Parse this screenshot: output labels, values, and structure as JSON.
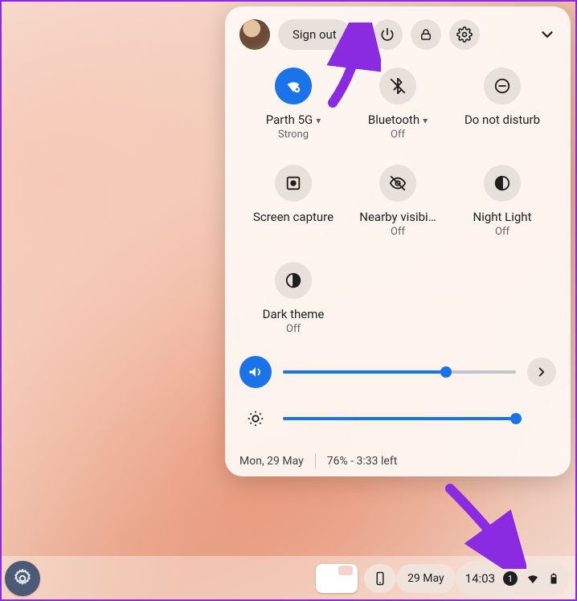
{
  "panel": {
    "signout_label": "Sign out",
    "tiles": [
      {
        "id": "wifi",
        "label": "Parth 5G",
        "sub": "Strong",
        "on": true,
        "has_chevron": true
      },
      {
        "id": "bluetooth",
        "label": "Bluetooth",
        "sub": "Off",
        "on": false,
        "has_chevron": true
      },
      {
        "id": "dnd",
        "label": "Do not disturb",
        "sub": "",
        "on": false,
        "has_chevron": false
      },
      {
        "id": "screencap",
        "label": "Screen capture",
        "sub": "",
        "on": false,
        "has_chevron": false
      },
      {
        "id": "nearby",
        "label": "Nearby visibility",
        "sub": "Off",
        "on": false,
        "has_chevron": false
      },
      {
        "id": "nightlight",
        "label": "Night Light",
        "sub": "Off",
        "on": false,
        "has_chevron": false
      },
      {
        "id": "darktheme",
        "label": "Dark theme",
        "sub": "Off",
        "on": false,
        "has_chevron": false
      }
    ],
    "volume_percent": 70,
    "brightness_percent": 100,
    "footer_date": "Mon, 29 May",
    "footer_battery": "76% - 3:33 left"
  },
  "shelf": {
    "date": "29 May",
    "time": "14:03",
    "notification_count": "1"
  }
}
